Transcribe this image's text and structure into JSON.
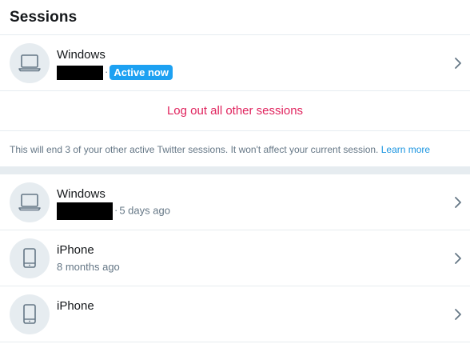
{
  "header": {
    "title": "Sessions"
  },
  "current_session": {
    "device": "Windows",
    "status_badge": "Active now"
  },
  "logout_all": {
    "label": "Log out all other sessions"
  },
  "note": {
    "text": "This will end 3 of your other active Twitter sessions. It won't affect your current session.",
    "learn_more": "Learn more"
  },
  "sessions": [
    {
      "device": "Windows",
      "meta": "5 days ago",
      "icon": "laptop-icon"
    },
    {
      "device": "iPhone",
      "meta": "8 months ago",
      "icon": "phone-icon"
    },
    {
      "device": "iPhone",
      "meta": "",
      "icon": "phone-icon"
    }
  ],
  "colors": {
    "accent": "#1da1f2",
    "danger": "#e0245e",
    "link": "#1b95e0",
    "muted": "#657786",
    "divider": "#e6ecf0"
  }
}
